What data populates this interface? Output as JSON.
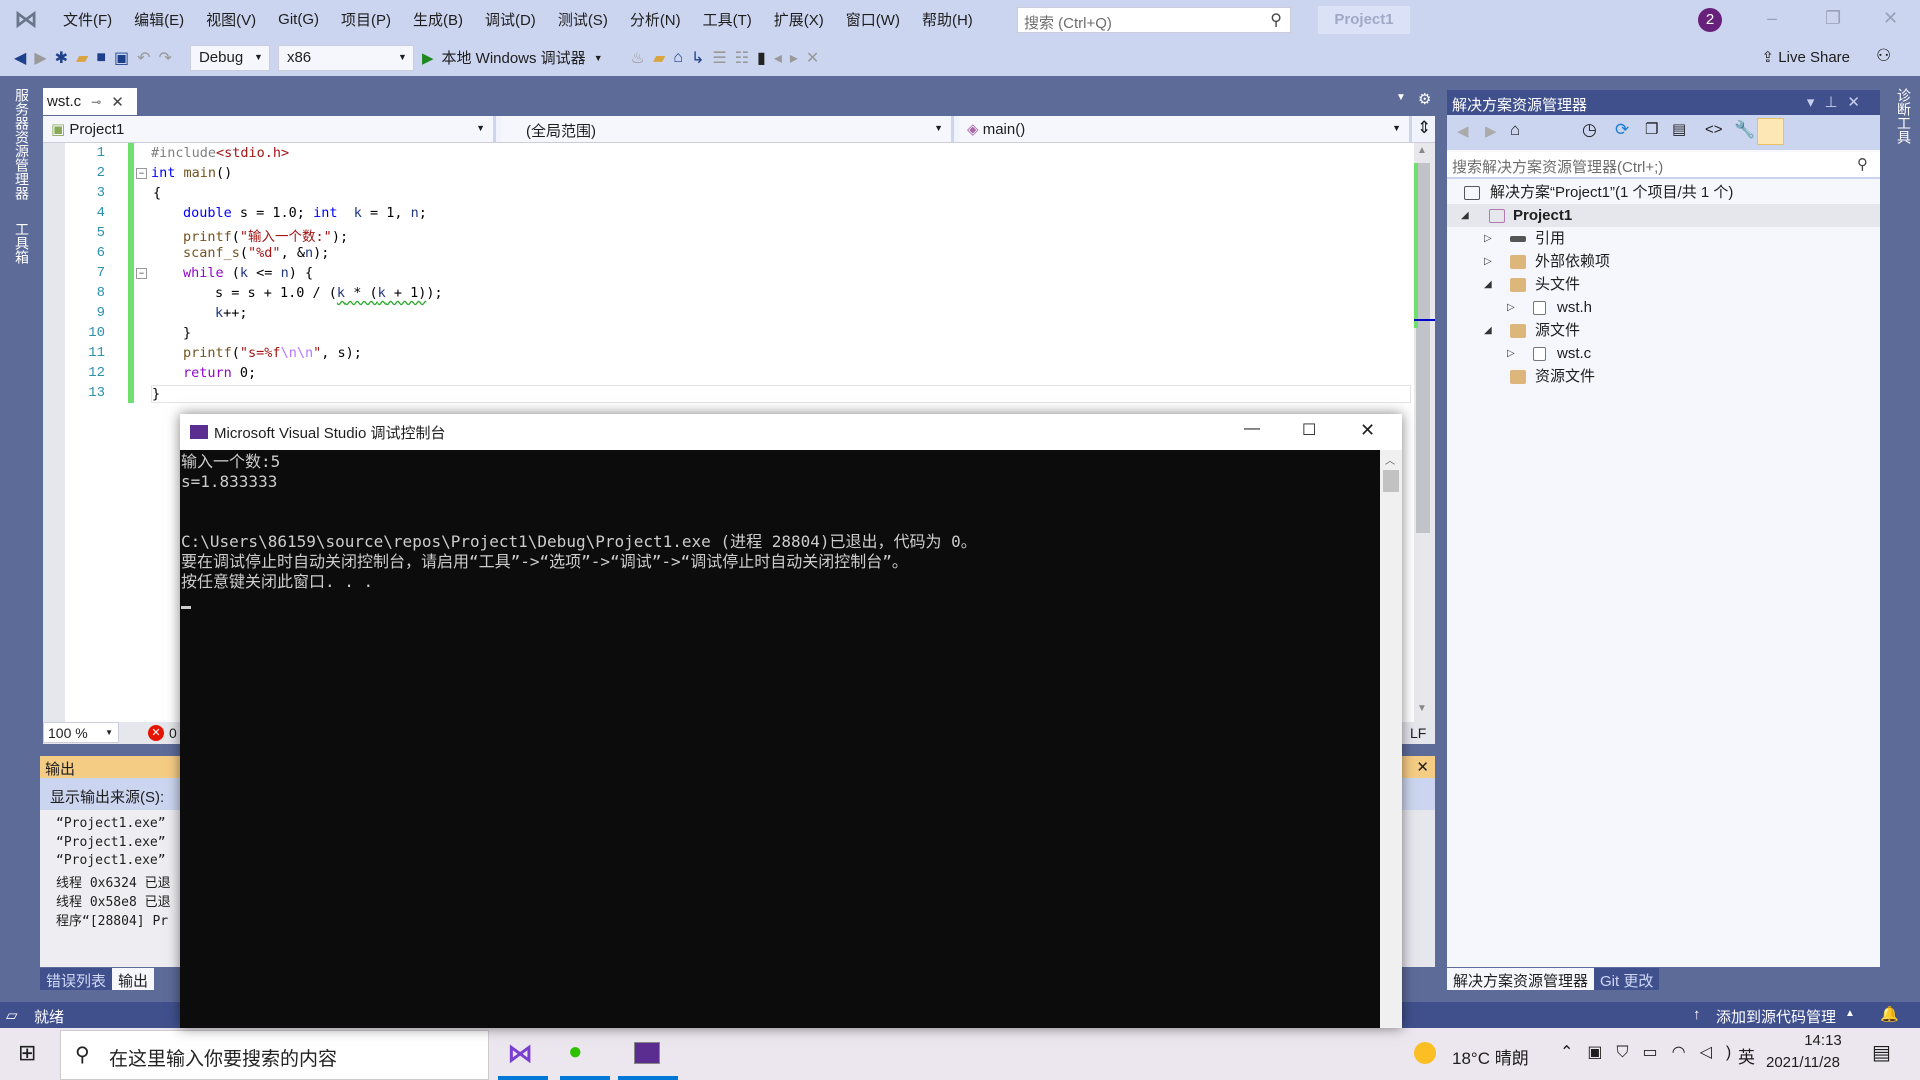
{
  "menu": {
    "items": [
      "文件(F)",
      "编辑(E)",
      "视图(V)",
      "Git(G)",
      "项目(P)",
      "生成(B)",
      "调试(D)",
      "测试(S)",
      "分析(N)",
      "工具(T)",
      "扩展(X)",
      "窗口(W)",
      "帮助(H)"
    ],
    "search_placeholder": "搜索 (Ctrl+Q)",
    "project": "Project1",
    "notifications": "2"
  },
  "toolbar": {
    "config": "Debug",
    "platform": "x86",
    "run": "本地 Windows 调试器",
    "live_share": "Live Share"
  },
  "left_strip": [
    "服务器资源管理器",
    "工具箱"
  ],
  "right_strip": [
    "诊断工具"
  ],
  "editor": {
    "tab": "wst.c",
    "nav": [
      "Project1",
      "(全局范围)",
      "main()"
    ],
    "zoom": "100 %",
    "errors": "0",
    "eol": "LF",
    "lines": [
      "1",
      "2",
      "3",
      "4",
      "5",
      "6",
      "7",
      "8",
      "9",
      "10",
      "11",
      "12",
      "13"
    ]
  },
  "output": {
    "title": "输出",
    "source_label": "显示输出来源(S):",
    "lines": [
      "“Project1.exe”",
      "“Project1.exe”",
      "“Project1.exe”",
      "线程 0x6324 已退",
      "线程 0x58e8 已退",
      "程序“[28804] Pr"
    ],
    "tabs": [
      "错误列表",
      "输出"
    ]
  },
  "console": {
    "title": "Microsoft Visual Studio 调试控制台",
    "lines": [
      "输入一个数:5",
      "s=1.833333",
      "",
      "",
      "C:\\Users\\86159\\source\\repos\\Project1\\Debug\\Project1.exe (进程 28804)已退出，代码为 0。",
      "要在调试停止时自动关闭控制台，请启用“工具”->“选项”->“调试”->“调试停止时自动关闭控制台”。",
      "按任意键关闭此窗口. . ."
    ]
  },
  "solution_explorer": {
    "title": "解决方案资源管理器",
    "search_placeholder": "搜索解决方案资源管理器(Ctrl+;)",
    "tree": [
      "解决方案“Project1”(1 个项目/共 1 个)",
      "Project1",
      "引用",
      "外部依赖项",
      "头文件",
      "wst.h",
      "源文件",
      "wst.c",
      "资源文件"
    ],
    "tabs": [
      "解决方案资源管理器",
      "Git 更改"
    ]
  },
  "status": {
    "ready": "就绪",
    "source_control": "添加到源代码管理"
  },
  "taskbar": {
    "search_placeholder": "在这里输入你要搜索的内容",
    "weather": "18°C  晴朗",
    "ime": "英",
    "time": "14:13",
    "date": "2021/11/28"
  }
}
